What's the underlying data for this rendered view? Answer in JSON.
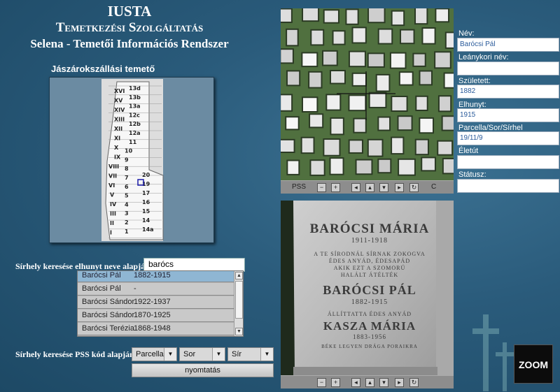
{
  "header": {
    "title": "IUSTA",
    "subtitle": "Temetkezési Szolgáltatás",
    "system": "Selena - Temetői Információs Rendszer"
  },
  "cemetery": {
    "name": "Jászárokszállási temető",
    "plots_left": [
      "XVI",
      "XV",
      "XIV",
      "XIII",
      "XII",
      "XI",
      "X",
      "IX",
      "VIII",
      "VII",
      "VI",
      "V",
      "IV",
      "III",
      "II",
      "I"
    ],
    "plots_right": [
      "13d",
      "13b",
      "13a",
      "12c",
      "12b",
      "12a",
      "11",
      "10",
      "9",
      "8",
      "7",
      "6",
      "5",
      "4",
      "3",
      "2",
      "1"
    ],
    "plots_far": [
      "20",
      "19",
      "17",
      "16",
      "15",
      "14",
      "14a"
    ]
  },
  "search": {
    "name_label": "Sírhely keresése elhunyt neve alapján:",
    "name_value": "barócs",
    "results": [
      {
        "name": "Barócsi Pál",
        "years": "1882-1915",
        "selected": true
      },
      {
        "name": "Barócsi Pál",
        "years": "-"
      },
      {
        "name": "Barócsi Sándor",
        "years": "1922-1937"
      },
      {
        "name": "Barócsi Sándor",
        "years": "1870-1925"
      },
      {
        "name": "Barócsi Terézia",
        "years": "1868-1948"
      }
    ],
    "pss_label": "Sírhely keresése PSS kód alapján:",
    "parcella": "Parcella",
    "sor": "Sor",
    "sir": "Sír",
    "print": "nyomtatás"
  },
  "aerial_controls": {
    "pss": "PSS",
    "c": "C",
    "icons": [
      "minus-icon",
      "plus-icon",
      "arrow-left-icon",
      "arrow-up-icon",
      "arrow-down-icon",
      "arrow-right-icon",
      "refresh-icon"
    ]
  },
  "headstone": {
    "lines": [
      "BARÓCSI MÁRIA",
      "1911-1918",
      "A TE SÍRODNÁL SÍRNAK ZOKOGVA",
      "ÉDES ANYÁD, ÉDESAPÁD",
      "AKIK EZT A SZOMORÚ",
      "HALÁLT ÁTÉLTÉK",
      "BARÓCSI PÁL",
      "1882-1915",
      "ÁLLÍTTATTA ÉDES ANYÁD",
      "KASZA MÁRIA",
      "1883-1956",
      "BÉKE LEGYEN DRÁGA PORAIKRA"
    ]
  },
  "info": {
    "nev_label": "Név:",
    "nev": "Barócsi Pál",
    "leanykori_label": "Leánykori név:",
    "leanykori": "",
    "szuletett_label": "Született:",
    "szuletett": "1882",
    "elhunyt_label": "Elhunyt:",
    "elhunyt": "1915",
    "pss_label": "Parcella/Sor/Sírhel",
    "pss": "19/11/9",
    "eletut_label": "Életút",
    "eletut": "",
    "statusz_label": "Státusz:",
    "statusz": ""
  },
  "logo": "ZOOM"
}
